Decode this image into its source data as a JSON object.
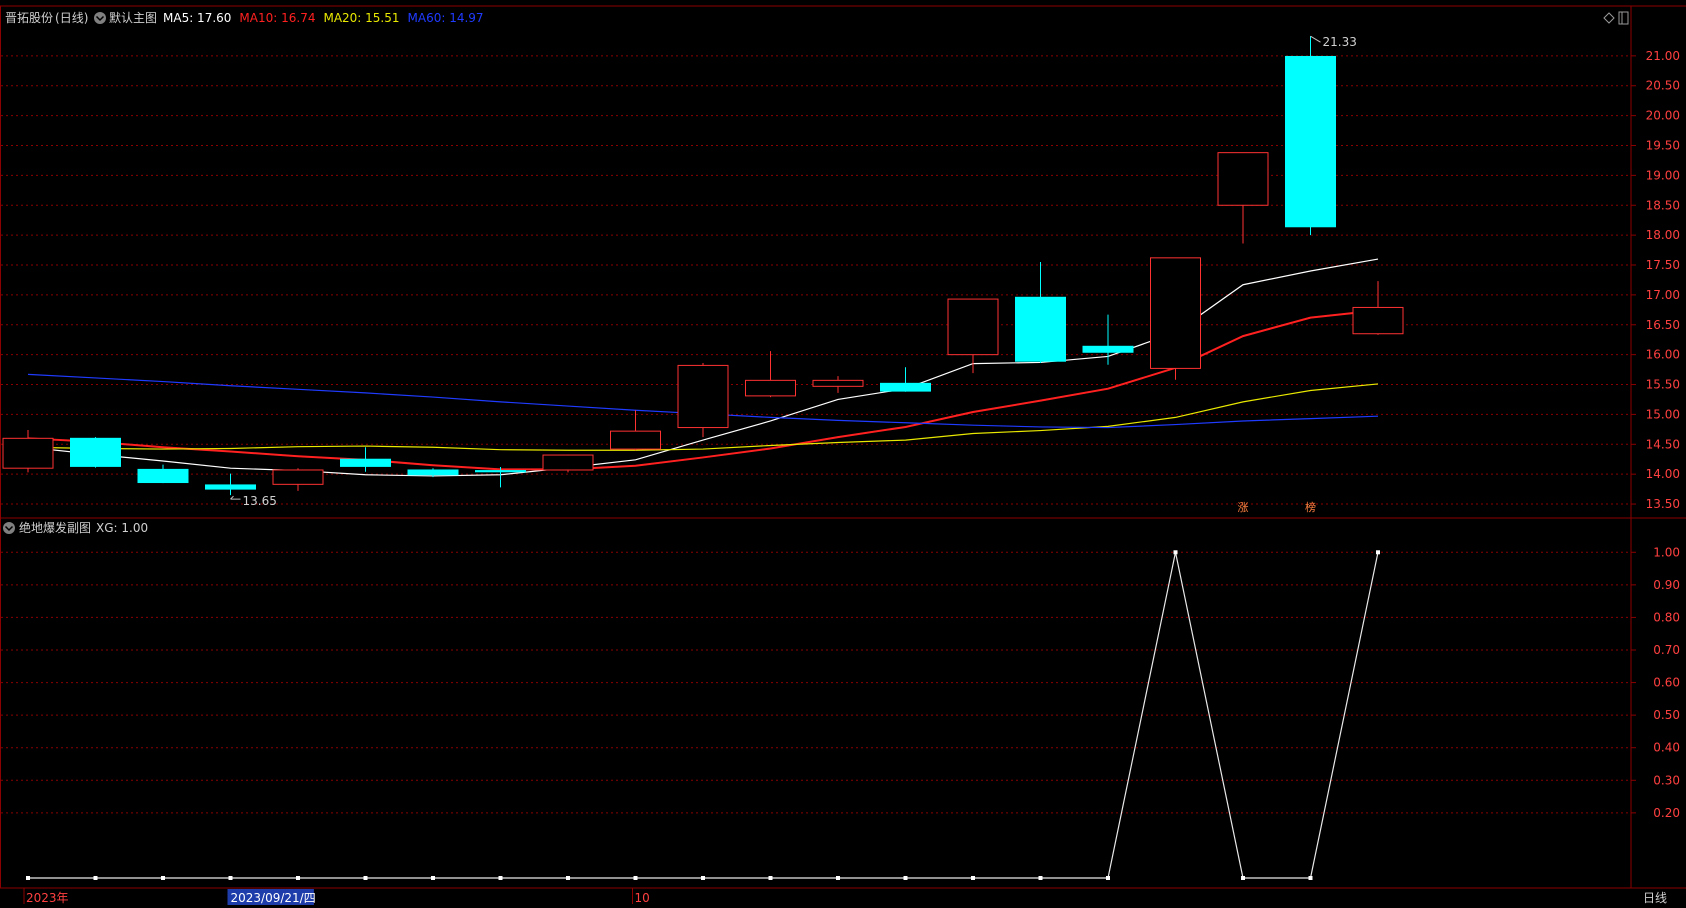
{
  "main_panel": {
    "stock_name": "晋拓股份",
    "period": "(日线)",
    "chart_name": "默认主图",
    "indicators": [
      {
        "label": "MA5: 17.60",
        "color": "#ffffff"
      },
      {
        "label": "MA10: 16.74",
        "color": "#ff2020"
      },
      {
        "label": "MA20: 15.51",
        "color": "#e8e800"
      },
      {
        "label": "MA60: 14.97",
        "color": "#1f3bff"
      }
    ],
    "high_label": "21.33",
    "low_label": "13.65",
    "markers": [
      "涨",
      "榜"
    ]
  },
  "sub_panel": {
    "title": "绝地爆发副图",
    "indicator_label": "XG: 1.00"
  },
  "time_axis": {
    "labels": [
      {
        "text": "2023年",
        "index": 0
      },
      {
        "text": "2023/09/21/四",
        "index": 3,
        "highlight": true
      },
      {
        "text": "10",
        "index": 9
      }
    ],
    "period_button": "日线"
  },
  "colors": {
    "up": "#ff3232",
    "down": "#00ffff",
    "grid": "#8b0000",
    "axis_text": "#ff4040",
    "ma5": "#ffffff",
    "ma10": "#ff2020",
    "ma20": "#e8e800",
    "ma60": "#1f3bff"
  },
  "chart_data": [
    {
      "type": "candlestick",
      "title": "晋拓股份 (日线)",
      "y_ticks": [
        21.0,
        20.5,
        20.0,
        19.5,
        19.0,
        18.5,
        18.0,
        17.5,
        17.0,
        16.5,
        16.0,
        15.5,
        15.0,
        14.5,
        14.0,
        13.5
      ],
      "ylim": [
        13.3,
        21.6
      ],
      "candles": [
        {
          "open": 14.1,
          "high": 14.74,
          "low": 14.03,
          "close": 14.6
        },
        {
          "open": 14.6,
          "high": 14.62,
          "low": 14.11,
          "close": 14.13
        },
        {
          "open": 14.08,
          "high": 14.16,
          "low": 13.85,
          "close": 13.86
        },
        {
          "open": 13.82,
          "high": 14.01,
          "low": 13.65,
          "close": 13.75
        },
        {
          "open": 13.83,
          "high": 14.1,
          "low": 13.72,
          "close": 14.07
        },
        {
          "open": 14.25,
          "high": 14.45,
          "low": 14.04,
          "close": 14.13
        },
        {
          "open": 14.07,
          "high": 14.1,
          "low": 13.95,
          "close": 13.99
        },
        {
          "open": 14.06,
          "high": 14.12,
          "low": 13.78,
          "close": 14.04
        },
        {
          "open": 14.07,
          "high": 14.33,
          "low": 14.03,
          "close": 14.32
        },
        {
          "open": 14.42,
          "high": 15.07,
          "low": 14.4,
          "close": 14.72
        },
        {
          "open": 14.78,
          "high": 15.86,
          "low": 14.62,
          "close": 15.82
        },
        {
          "open": 15.31,
          "high": 16.06,
          "low": 15.29,
          "close": 15.57
        },
        {
          "open": 15.47,
          "high": 15.64,
          "low": 15.36,
          "close": 15.57
        },
        {
          "open": 15.52,
          "high": 15.79,
          "low": 15.38,
          "close": 15.39
        },
        {
          "open": 16.0,
          "high": 16.93,
          "low": 15.69,
          "close": 16.93
        },
        {
          "open": 16.96,
          "high": 17.55,
          "low": 15.86,
          "close": 15.89
        },
        {
          "open": 16.14,
          "high": 16.67,
          "low": 15.83,
          "close": 16.04
        },
        {
          "open": 15.77,
          "high": 17.62,
          "low": 15.58,
          "close": 17.62
        },
        {
          "open": 18.5,
          "high": 19.38,
          "low": 17.86,
          "close": 19.38
        },
        {
          "open": 20.99,
          "high": 21.33,
          "low": 18.0,
          "close": 18.14
        },
        {
          "open": 16.35,
          "high": 17.23,
          "low": 16.33,
          "close": 16.79
        }
      ],
      "series": [
        {
          "name": "MA5",
          "values": [
            14.45,
            14.33,
            14.22,
            14.1,
            14.06,
            13.99,
            13.97,
            13.99,
            14.11,
            14.24,
            14.57,
            14.89,
            15.25,
            15.43,
            15.85,
            15.87,
            15.97,
            16.37,
            17.17,
            17.4,
            17.6
          ]
        },
        {
          "name": "MA10",
          "values": [
            14.6,
            14.54,
            14.45,
            14.38,
            14.3,
            14.24,
            14.15,
            14.08,
            14.08,
            14.14,
            14.28,
            14.43,
            14.62,
            14.79,
            15.04,
            15.23,
            15.43,
            15.78,
            16.31,
            16.62,
            16.74
          ]
        },
        {
          "name": "MA20",
          "values": [
            14.45,
            14.43,
            14.42,
            14.43,
            14.46,
            14.47,
            14.45,
            14.41,
            14.4,
            14.4,
            14.42,
            14.48,
            14.53,
            14.57,
            14.68,
            14.73,
            14.8,
            14.95,
            15.21,
            15.4,
            15.51
          ]
        },
        {
          "name": "MA60",
          "values": [
            15.67,
            15.61,
            15.55,
            15.48,
            15.42,
            15.36,
            15.29,
            15.21,
            15.14,
            15.07,
            15.01,
            14.95,
            14.9,
            14.86,
            14.82,
            14.79,
            14.78,
            14.83,
            14.89,
            14.93,
            14.97
          ]
        }
      ]
    },
    {
      "type": "line",
      "title": "绝地爆发副图",
      "y_ticks": [
        1.0,
        0.9,
        0.8,
        0.7,
        0.6,
        0.5,
        0.4,
        0.3,
        0.2
      ],
      "ylim": [
        0,
        1.05
      ],
      "series": [
        {
          "name": "XG",
          "values": [
            0,
            0,
            0,
            0,
            0,
            0,
            0,
            0,
            0,
            0,
            0,
            0,
            0,
            0,
            0,
            0,
            0,
            1,
            0,
            0,
            1
          ]
        }
      ]
    }
  ]
}
